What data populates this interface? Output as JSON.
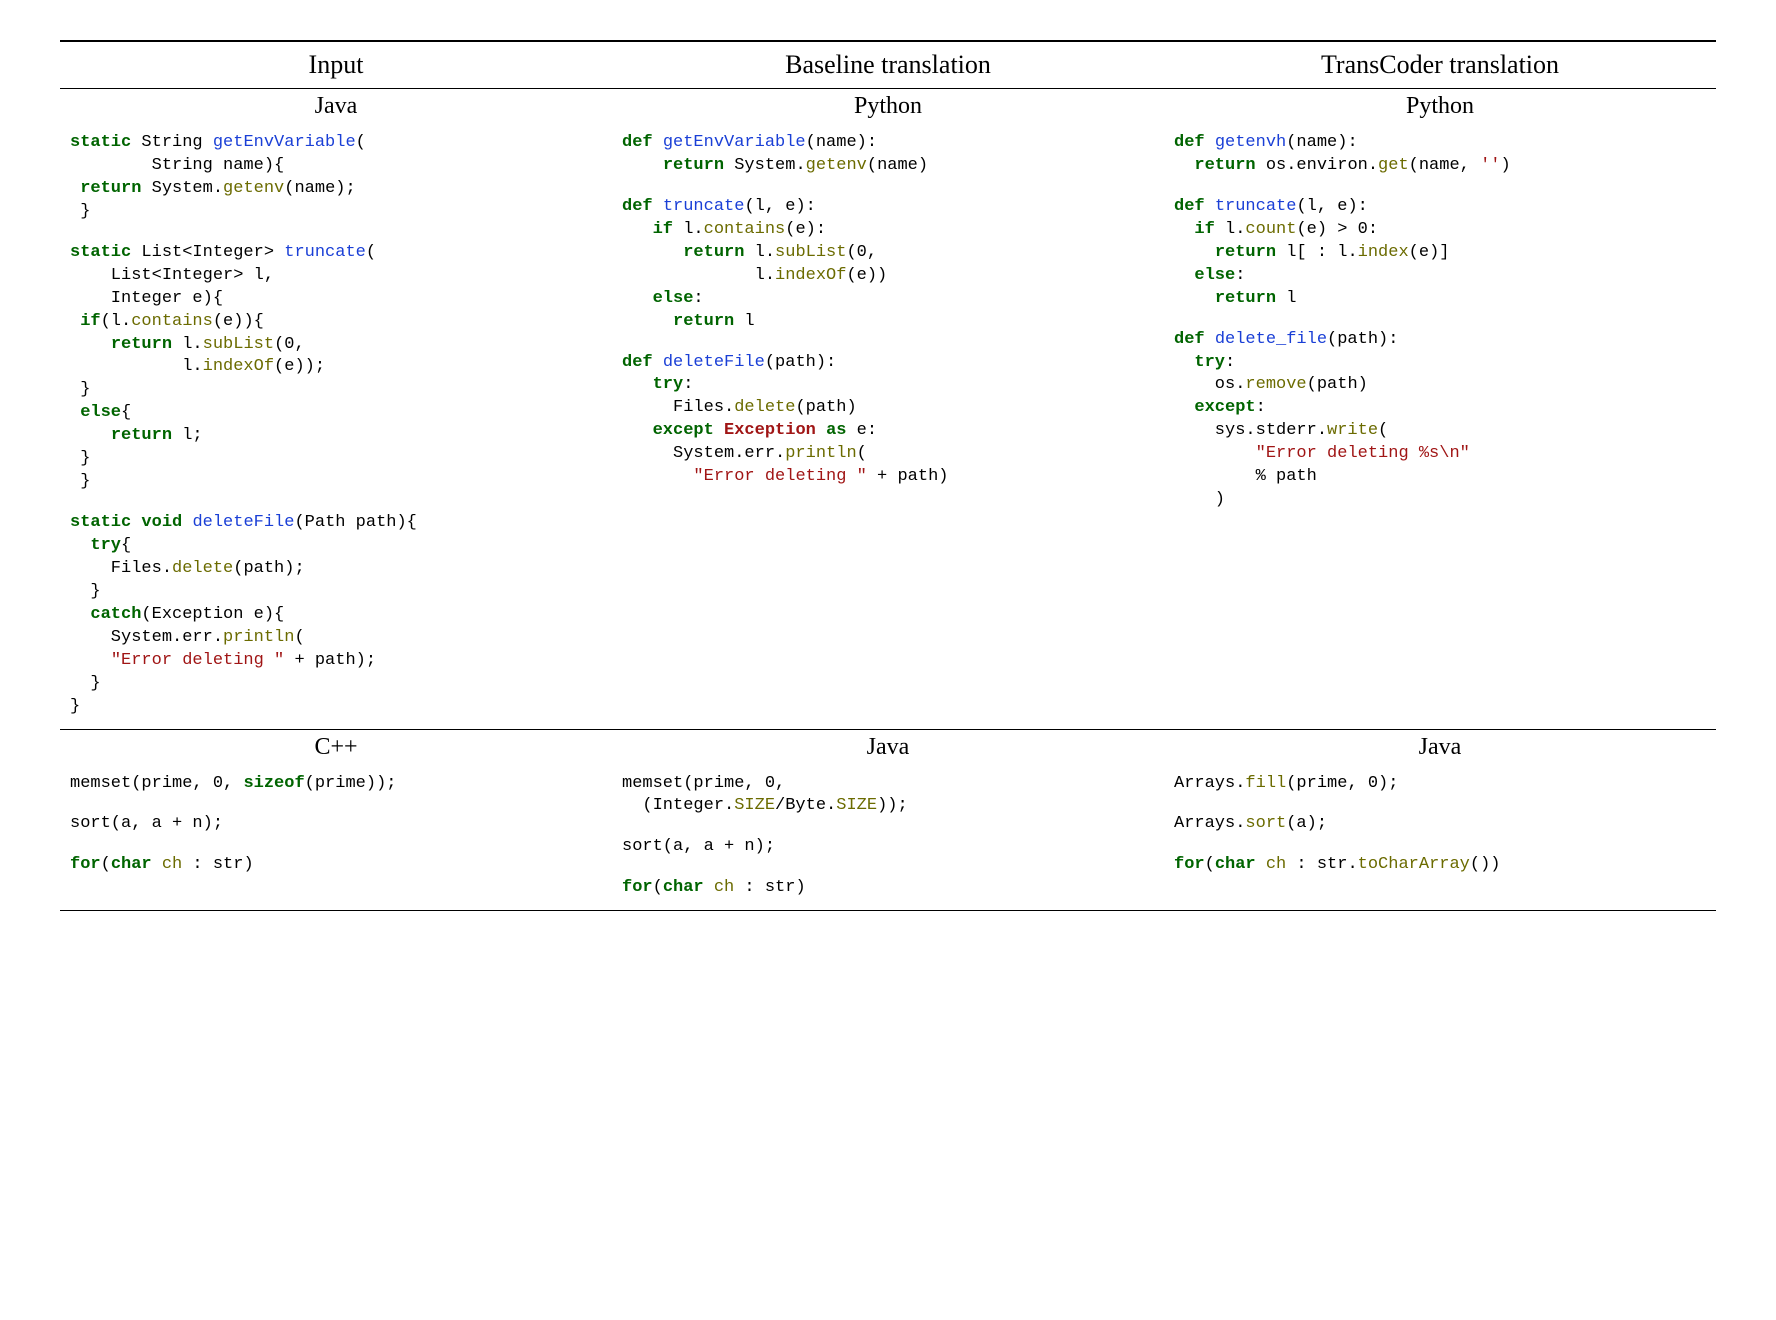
{
  "headers": [
    "Input",
    "Baseline translation",
    "TransCoder translation"
  ],
  "section1": {
    "langs": [
      "Java",
      "Python",
      "Python"
    ]
  },
  "section2": {
    "langs": [
      "C++",
      "Java",
      "Java"
    ]
  },
  "ex": {
    "env_java": [
      {
        "t": "kw",
        "v": "static"
      },
      {
        "v": " String "
      },
      {
        "t": "fn",
        "v": "getEnvVariable"
      },
      {
        "v": "(\n        String name){\n "
      },
      {
        "t": "kw",
        "v": "return"
      },
      {
        "v": " System."
      },
      {
        "t": "call",
        "v": "getenv"
      },
      {
        "v": "(name);\n }"
      }
    ],
    "env_base": [
      {
        "t": "kw",
        "v": "def"
      },
      {
        "v": " "
      },
      {
        "t": "fn",
        "v": "getEnvVariable"
      },
      {
        "v": "(name):\n    "
      },
      {
        "t": "kw",
        "v": "return"
      },
      {
        "v": " System."
      },
      {
        "t": "call",
        "v": "getenv"
      },
      {
        "v": "(name)"
      }
    ],
    "env_tc": [
      {
        "t": "kw",
        "v": "def"
      },
      {
        "v": " "
      },
      {
        "t": "fn",
        "v": "getenvh"
      },
      {
        "v": "(name):\n  "
      },
      {
        "t": "kw",
        "v": "return"
      },
      {
        "v": " os.environ."
      },
      {
        "t": "call",
        "v": "get"
      },
      {
        "v": "(name, "
      },
      {
        "t": "str",
        "v": "''"
      },
      {
        "v": ")"
      }
    ],
    "trunc_java": [
      {
        "t": "kw",
        "v": "static"
      },
      {
        "v": " List<Integer> "
      },
      {
        "t": "fn",
        "v": "truncate"
      },
      {
        "v": "(\n    List<Integer> l,\n    Integer e){\n "
      },
      {
        "t": "kw",
        "v": "if"
      },
      {
        "v": "(l."
      },
      {
        "t": "call",
        "v": "contains"
      },
      {
        "v": "(e)){\n    "
      },
      {
        "t": "kw",
        "v": "return"
      },
      {
        "v": " l."
      },
      {
        "t": "call",
        "v": "subList"
      },
      {
        "v": "(0,\n           l."
      },
      {
        "t": "call",
        "v": "indexOf"
      },
      {
        "v": "(e));\n }\n "
      },
      {
        "t": "kw",
        "v": "else"
      },
      {
        "v": "{\n    "
      },
      {
        "t": "kw",
        "v": "return"
      },
      {
        "v": " l;\n }\n }"
      }
    ],
    "trunc_base": [
      {
        "t": "kw",
        "v": "def"
      },
      {
        "v": " "
      },
      {
        "t": "fn",
        "v": "truncate"
      },
      {
        "v": "(l, e):\n   "
      },
      {
        "t": "kw",
        "v": "if"
      },
      {
        "v": " l."
      },
      {
        "t": "call",
        "v": "contains"
      },
      {
        "v": "(e):\n      "
      },
      {
        "t": "kw",
        "v": "return"
      },
      {
        "v": " l."
      },
      {
        "t": "call",
        "v": "subList"
      },
      {
        "v": "(0,\n             l."
      },
      {
        "t": "call",
        "v": "indexOf"
      },
      {
        "v": "(e))\n   "
      },
      {
        "t": "kw",
        "v": "else"
      },
      {
        "v": ":\n     "
      },
      {
        "t": "kw",
        "v": "return"
      },
      {
        "v": " l"
      }
    ],
    "trunc_tc": [
      {
        "t": "kw",
        "v": "def"
      },
      {
        "v": " "
      },
      {
        "t": "fn",
        "v": "truncate"
      },
      {
        "v": "(l, e):\n  "
      },
      {
        "t": "kw",
        "v": "if"
      },
      {
        "v": " l."
      },
      {
        "t": "call",
        "v": "count"
      },
      {
        "v": "(e) > 0:\n    "
      },
      {
        "t": "kw",
        "v": "return"
      },
      {
        "v": " l[ : l."
      },
      {
        "t": "call",
        "v": "index"
      },
      {
        "v": "(e)]\n  "
      },
      {
        "t": "kw",
        "v": "else"
      },
      {
        "v": ":\n    "
      },
      {
        "t": "kw",
        "v": "return"
      },
      {
        "v": " l"
      }
    ],
    "del_java": [
      {
        "t": "kw",
        "v": "static"
      },
      {
        "v": " "
      },
      {
        "t": "kw",
        "v": "void"
      },
      {
        "v": " "
      },
      {
        "t": "fn",
        "v": "deleteFile"
      },
      {
        "v": "(Path path){\n  "
      },
      {
        "t": "kw",
        "v": "try"
      },
      {
        "v": "{\n    Files."
      },
      {
        "t": "call",
        "v": "delete"
      },
      {
        "v": "(path);\n  }\n  "
      },
      {
        "t": "kw",
        "v": "catch"
      },
      {
        "v": "(Exception e){\n    System.err."
      },
      {
        "t": "call",
        "v": "println"
      },
      {
        "v": "(\n    "
      },
      {
        "t": "str",
        "v": "\"Error deleting \""
      },
      {
        "v": " + path);\n  }\n}"
      }
    ],
    "del_base": [
      {
        "t": "kw",
        "v": "def"
      },
      {
        "v": " "
      },
      {
        "t": "fn",
        "v": "deleteFile"
      },
      {
        "v": "(path):\n   "
      },
      {
        "t": "kw",
        "v": "try"
      },
      {
        "v": ":\n     Files."
      },
      {
        "t": "call",
        "v": "delete"
      },
      {
        "v": "(path)\n   "
      },
      {
        "t": "kw",
        "v": "except"
      },
      {
        "v": " "
      },
      {
        "t": "exc",
        "v": "Exception"
      },
      {
        "v": " "
      },
      {
        "t": "kw",
        "v": "as"
      },
      {
        "v": " e:\n     System.err."
      },
      {
        "t": "call",
        "v": "println"
      },
      {
        "v": "(\n       "
      },
      {
        "t": "str",
        "v": "\"Error deleting \""
      },
      {
        "v": " + path)"
      }
    ],
    "del_tc": [
      {
        "t": "kw",
        "v": "def"
      },
      {
        "v": " "
      },
      {
        "t": "fn",
        "v": "delete_file"
      },
      {
        "v": "(path):\n  "
      },
      {
        "t": "kw",
        "v": "try"
      },
      {
        "v": ":\n    os."
      },
      {
        "t": "call",
        "v": "remove"
      },
      {
        "v": "(path)\n  "
      },
      {
        "t": "kw",
        "v": "except"
      },
      {
        "v": ":\n    sys.stderr."
      },
      {
        "t": "call",
        "v": "write"
      },
      {
        "v": "(\n        "
      },
      {
        "t": "str",
        "v": "\"Error deleting %s\\n\""
      },
      {
        "v": "\n        % path\n    )"
      }
    ],
    "memset_cpp": [
      {
        "v": "memset(prime, 0, "
      },
      {
        "t": "kw",
        "v": "sizeof"
      },
      {
        "v": "(prime));"
      }
    ],
    "memset_base": [
      {
        "v": "memset(prime, 0,\n  (Integer."
      },
      {
        "t": "call",
        "v": "SIZE"
      },
      {
        "v": "/Byte."
      },
      {
        "t": "call",
        "v": "SIZE"
      },
      {
        "v": "));"
      }
    ],
    "memset_tc": [
      {
        "v": "Arrays."
      },
      {
        "t": "call",
        "v": "fill"
      },
      {
        "v": "(prime, 0);"
      }
    ],
    "sort_cpp": [
      {
        "v": "sort(a, a + n);"
      }
    ],
    "sort_base": [
      {
        "v": "sort(a, a + n);"
      }
    ],
    "sort_tc": [
      {
        "v": "Arrays."
      },
      {
        "t": "call",
        "v": "sort"
      },
      {
        "v": "(a);"
      }
    ],
    "for_cpp": [
      {
        "t": "kw",
        "v": "for"
      },
      {
        "v": "("
      },
      {
        "t": "kw",
        "v": "char"
      },
      {
        "v": " "
      },
      {
        "t": "call",
        "v": "ch"
      },
      {
        "v": " : str)"
      }
    ],
    "for_base": [
      {
        "t": "kw",
        "v": "for"
      },
      {
        "v": "("
      },
      {
        "t": "kw",
        "v": "char"
      },
      {
        "v": " "
      },
      {
        "t": "call",
        "v": "ch"
      },
      {
        "v": " : str)"
      }
    ],
    "for_tc": [
      {
        "t": "kw",
        "v": "for"
      },
      {
        "v": "("
      },
      {
        "t": "kw",
        "v": "char"
      },
      {
        "v": " "
      },
      {
        "t": "call",
        "v": "ch"
      },
      {
        "v": " : str."
      },
      {
        "t": "call",
        "v": "toCharArray"
      },
      {
        "v": "())"
      }
    ]
  }
}
